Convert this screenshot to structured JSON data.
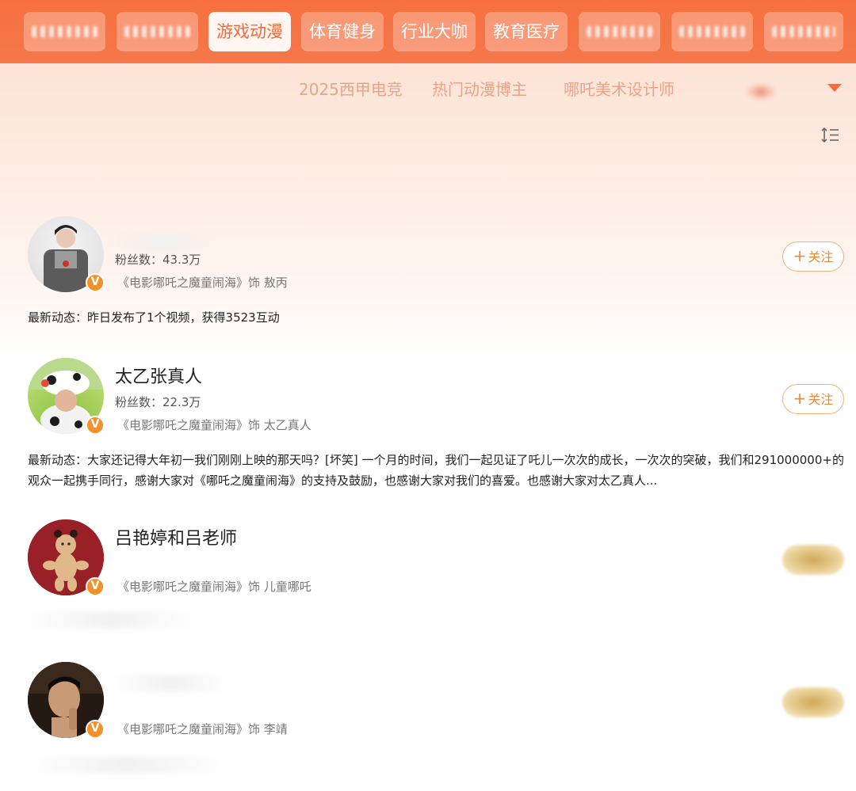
{
  "categories": [
    {
      "label": "",
      "blurred": true
    },
    {
      "label": "",
      "blurred": true
    },
    {
      "label": "游戏动漫",
      "blurred": false,
      "active": true
    },
    {
      "label": "体育健身",
      "blurred": false
    },
    {
      "label": "行业大咖",
      "blurred": false
    },
    {
      "label": "教育医疗",
      "blurred": false
    },
    {
      "label": "",
      "blurred": true
    },
    {
      "label": "",
      "blurred": true
    },
    {
      "label": "",
      "blurred": true
    }
  ],
  "subtags": [
    "2025西甲电竞",
    "热门动漫博主",
    "哪吒美术设计师"
  ],
  "users": [
    {
      "name": "",
      "fans": "粉丝数：43.3万",
      "role": "《电影哪吒之魔童闹海》饰 敖丙",
      "recent": "最新动态：昨日发布了1个视频，获得3523互动",
      "follow": "关注",
      "verified": "V"
    },
    {
      "name": "太乙张真人",
      "fans": "粉丝数：22.3万",
      "role": "《电影哪吒之魔童闹海》饰 太乙真人",
      "recent": "最新动态：大家还记得大年初一我们刚刚上映的那天吗？[坏笑] 一个月的时间，我们一起见证了吒儿一次次的成长，一次次的突破，我们和291000000+的观众一起携手同行，感谢大家对《哪吒之魔童闹海》的支持及鼓励，也感谢大家对我们的喜爱。也感谢大家对太乙真人...",
      "follow": "关注",
      "verified": "V"
    },
    {
      "name": "吕艳婷和吕老师",
      "fans": "",
      "role": "《电影哪吒之魔童闹海》饰 儿童哪吒",
      "recent": "",
      "follow": "",
      "verified": "V"
    },
    {
      "name": "",
      "fans": "",
      "role": "《电影哪吒之魔童闹海》饰 李靖",
      "recent": "",
      "follow": "",
      "verified": "V"
    }
  ],
  "icons": {
    "dropdown": "chevron-down-icon",
    "sort": "sort-list-icon",
    "verified": "verified-badge-icon",
    "plus": "plus-icon"
  },
  "colors": {
    "accent": "#f6703f",
    "follow": "#e98a3e",
    "verified": "#f3902b"
  }
}
